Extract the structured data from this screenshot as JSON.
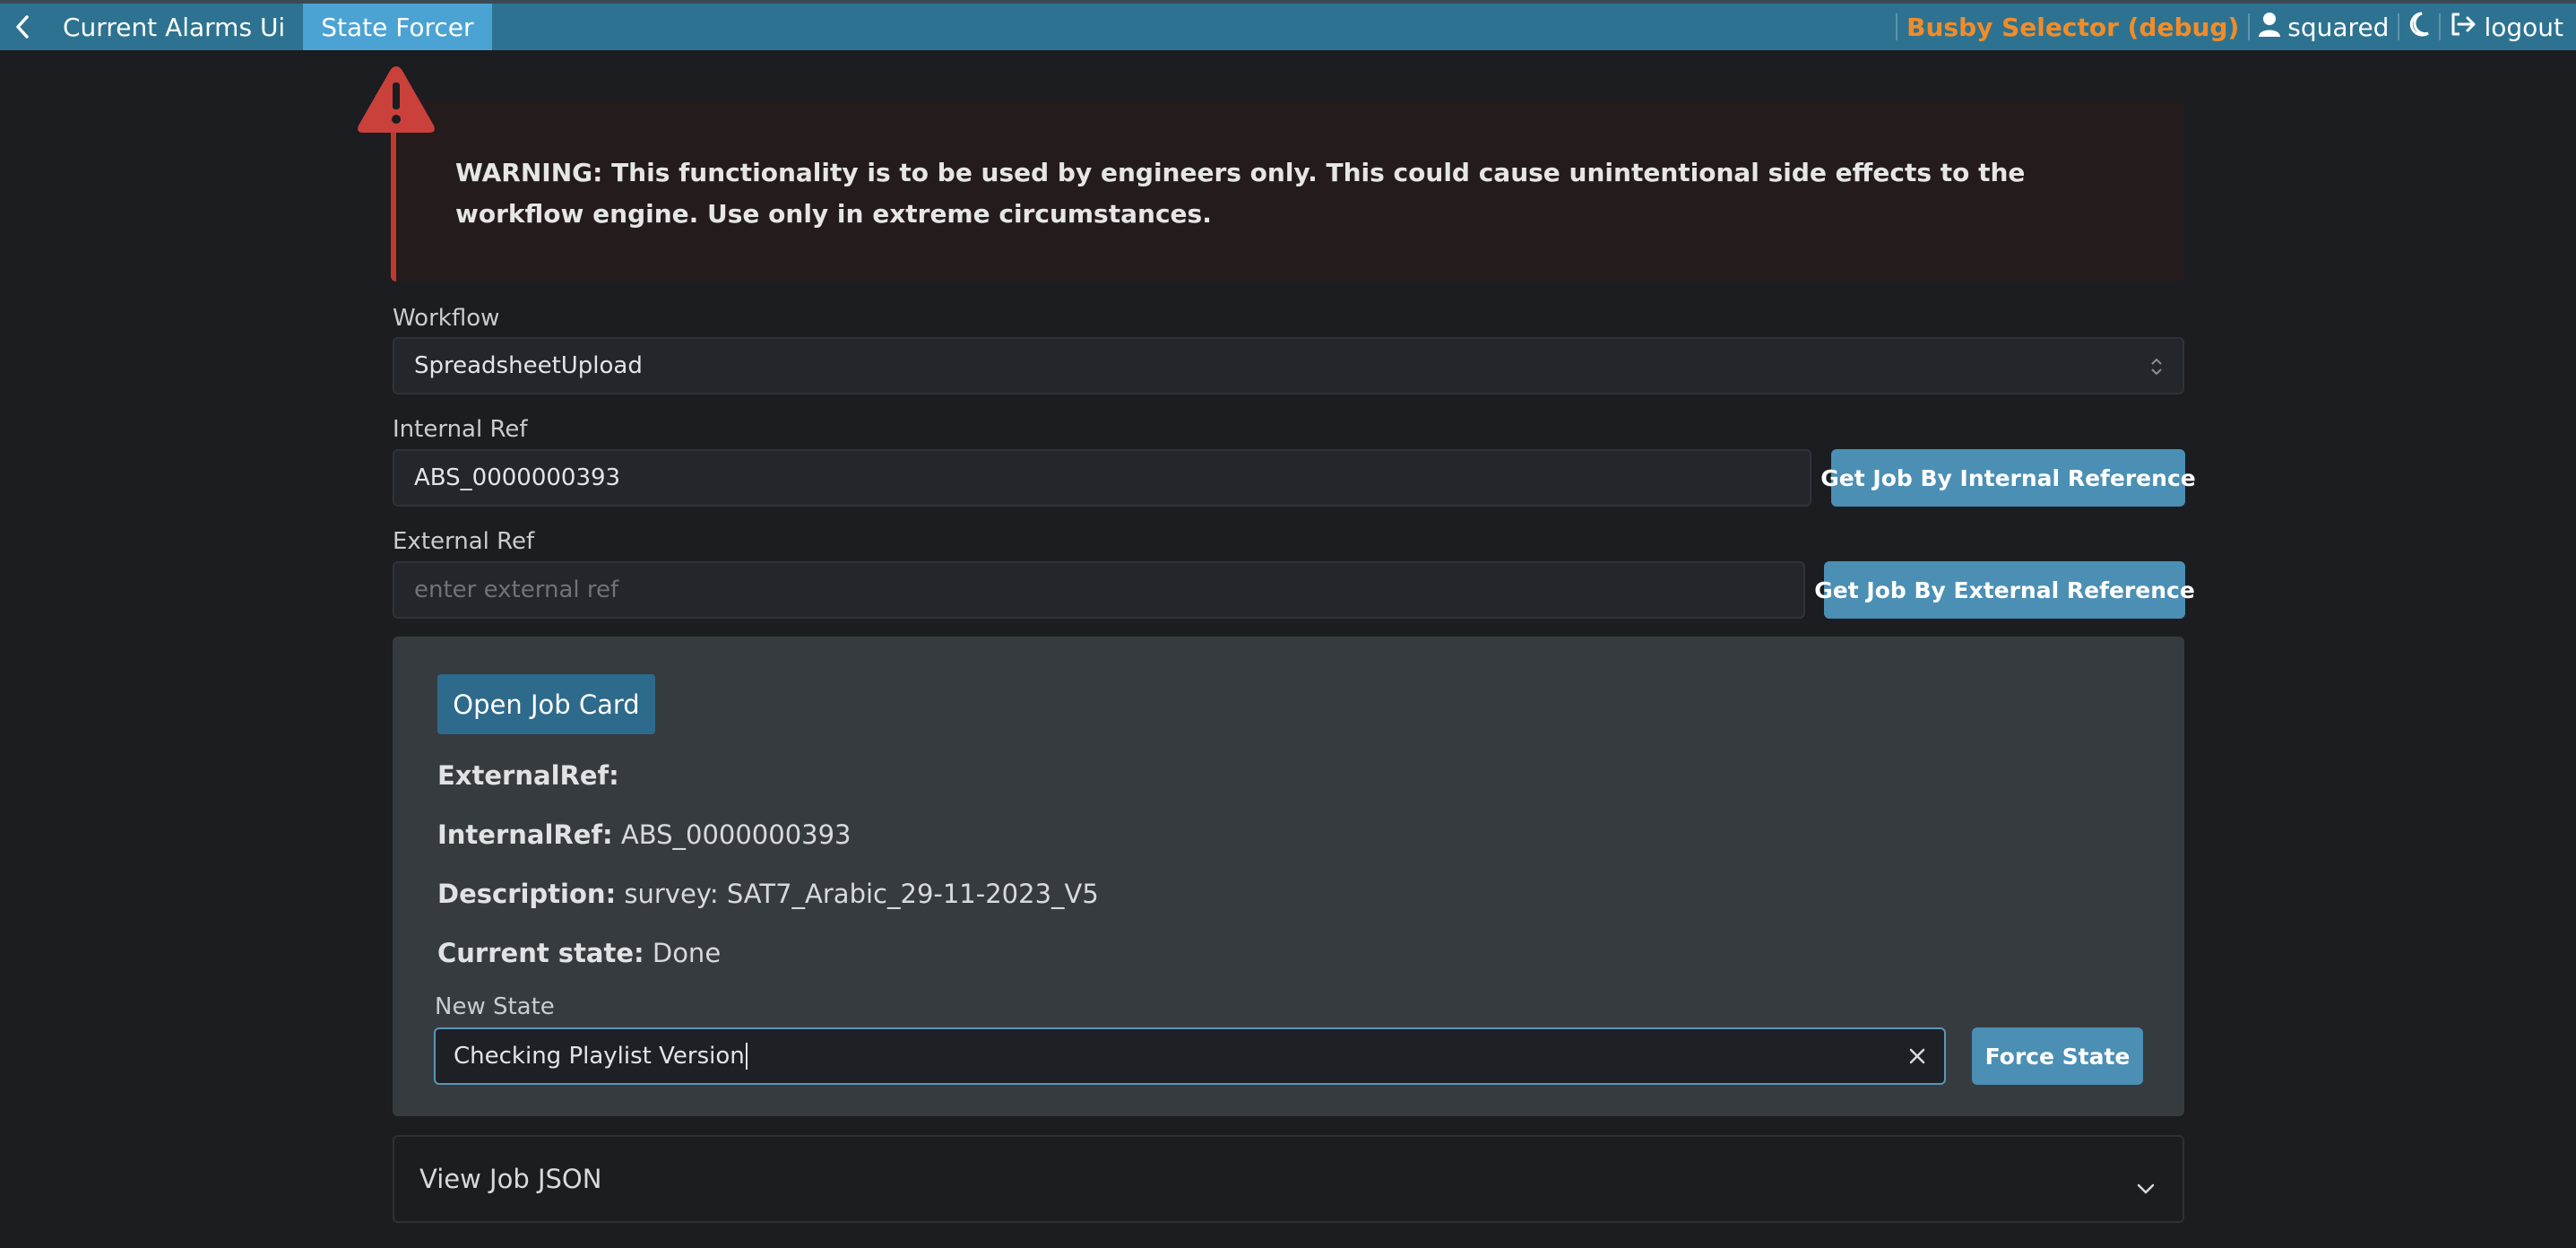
{
  "topbar": {
    "tabs": [
      {
        "label": "Current Alarms Ui",
        "active": false
      },
      {
        "label": "State Forcer",
        "active": true
      }
    ],
    "app_title": "Busby Selector (debug)",
    "user": "squared",
    "logout_label": "logout"
  },
  "warning": {
    "text": "WARNING: This functionality is to be used by engineers only. This could cause unintentional side effects to the workflow engine. Use only in extreme circumstances."
  },
  "form": {
    "workflow_label": "Workflow",
    "workflow_value": "SpreadsheetUpload",
    "internal_ref_label": "Internal Ref",
    "internal_ref_value": "ABS_0000000393",
    "internal_button": "Get Job By Internal Reference",
    "external_ref_label": "External Ref",
    "external_ref_placeholder": "enter external ref",
    "external_button": "Get Job By External Reference"
  },
  "job": {
    "open_button": "Open Job Card",
    "external_ref_key": "ExternalRef:",
    "external_ref_value": "",
    "internal_ref_key": "InternalRef:",
    "internal_ref_value": "ABS_0000000393",
    "description_key": "Description:",
    "description_value": "survey: SAT7_Arabic_29-11-2023_V5",
    "current_state_key": "Current state:",
    "current_state_value": "Done",
    "new_state_label": "New State",
    "new_state_value": "Checking Playlist Version",
    "force_button": "Force State"
  },
  "accordion": {
    "label": "View Job JSON"
  },
  "colors": {
    "topbar": "#2d7391",
    "active_tab": "#4ba3d3",
    "brand": "#f28c28",
    "warning_border": "#c0392b",
    "button": "#4b8fb5"
  }
}
